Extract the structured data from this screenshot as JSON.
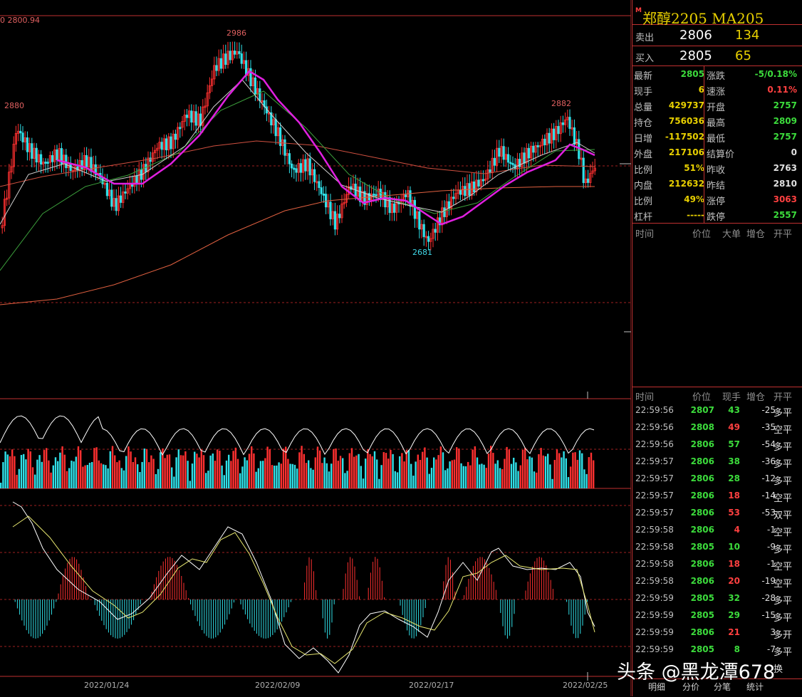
{
  "chart_header": {
    "ma_prefix": "0",
    "ma_value": "2800.94"
  },
  "peak_labels": {
    "left": "2880",
    "top": "2986",
    "bottom": "2681",
    "right": "2882"
  },
  "x_axis": [
    "2022/01/24",
    "2022/02/09",
    "2022/02/17",
    "2022/02/25"
  ],
  "quote": {
    "marker": "M",
    "title": "郑醇2205  MA205",
    "sell": {
      "label": "卖出",
      "price": "2806",
      "volume": "134"
    },
    "buy": {
      "label": "买入",
      "price": "2805",
      "volume": "65"
    }
  },
  "stats": [
    {
      "l1": "最新",
      "v1": "2805",
      "c1": "#3cdc3c",
      "l2": "涨跌",
      "v2": "-5/0.18%",
      "c2": "#3cdc3c"
    },
    {
      "l1": "现手",
      "v1": "6",
      "c1": "#e8d000",
      "l2": "速涨",
      "v2": "0.11%",
      "c2": "#ff4040"
    },
    {
      "l1": "总量",
      "v1": "429737",
      "c1": "#e8d000",
      "l2": "开盘",
      "v2": "2757",
      "c2": "#3cdc3c"
    },
    {
      "l1": "持仓",
      "v1": "756036",
      "c1": "#e8d000",
      "l2": "最高",
      "v2": "2809",
      "c2": "#3cdc3c"
    },
    {
      "l1": "日增",
      "v1": "-117502",
      "c1": "#e8d000",
      "l2": "最低",
      "v2": "2757",
      "c2": "#3cdc3c"
    },
    {
      "l1": "外盘",
      "v1": "217106",
      "c1": "#e8d000",
      "l2": "结算价",
      "v2": "0",
      "c2": "#e0e0e0"
    },
    {
      "l1": "比例",
      "v1": "51%",
      "c1": "#e8d000",
      "l2": "昨收",
      "v2": "2763",
      "c2": "#e0e0e0"
    },
    {
      "l1": "内盘",
      "v1": "212632",
      "c1": "#e8d000",
      "l2": "昨结",
      "v2": "2810",
      "c2": "#e0e0e0"
    },
    {
      "l1": "比例",
      "v1": "49%",
      "c1": "#e8d000",
      "l2": "涨停",
      "v2": "3063",
      "c2": "#ff4040"
    },
    {
      "l1": "杠杆",
      "v1": "-----",
      "c1": "#e8d000",
      "l2": "跌停",
      "v2": "2557",
      "c2": "#3cdc3c"
    }
  ],
  "big_order_header": [
    "时间",
    "价位",
    "大单",
    "增仓",
    "开平"
  ],
  "tick_header": [
    "时间",
    "价位",
    "现手",
    "增仓",
    "开平"
  ],
  "ticks": [
    {
      "time": "22:59:56",
      "price": "2807",
      "vol": "43",
      "vc": "#3cdc3c",
      "chg": "-25",
      "kind": "多平"
    },
    {
      "time": "22:59:56",
      "price": "2808",
      "vol": "49",
      "vc": "#ff4040",
      "chg": "-35",
      "kind": "空平"
    },
    {
      "time": "22:59:56",
      "price": "2806",
      "vol": "57",
      "vc": "#3cdc3c",
      "chg": "-54",
      "kind": "多平"
    },
    {
      "time": "22:59:57",
      "price": "2806",
      "vol": "38",
      "vc": "#3cdc3c",
      "chg": "-36",
      "kind": "多平"
    },
    {
      "time": "22:59:57",
      "price": "2806",
      "vol": "28",
      "vc": "#3cdc3c",
      "chg": "-12",
      "kind": "多平"
    },
    {
      "time": "22:59:57",
      "price": "2806",
      "vol": "18",
      "vc": "#ff4040",
      "chg": "-14",
      "kind": "空平"
    },
    {
      "time": "22:59:57",
      "price": "2806",
      "vol": "53",
      "vc": "#ff4040",
      "chg": "-53",
      "kind": "双平"
    },
    {
      "time": "22:59:58",
      "price": "2806",
      "vol": "4",
      "vc": "#ff4040",
      "chg": "-1",
      "kind": "空平"
    },
    {
      "time": "22:59:58",
      "price": "2805",
      "vol": "10",
      "vc": "#3cdc3c",
      "chg": "-9",
      "kind": "多平"
    },
    {
      "time": "22:59:58",
      "price": "2806",
      "vol": "18",
      "vc": "#ff4040",
      "chg": "-1",
      "kind": "空平"
    },
    {
      "time": "22:59:58",
      "price": "2806",
      "vol": "20",
      "vc": "#ff4040",
      "chg": "-19",
      "kind": "空平"
    },
    {
      "time": "22:59:59",
      "price": "2805",
      "vol": "32",
      "vc": "#3cdc3c",
      "chg": "-28",
      "kind": "多平"
    },
    {
      "time": "22:59:59",
      "price": "2805",
      "vol": "29",
      "vc": "#3cdc3c",
      "chg": "-15",
      "kind": "多平"
    },
    {
      "time": "22:59:59",
      "price": "2806",
      "vol": "21",
      "vc": "#ff4040",
      "chg": "3",
      "kind": "多开"
    },
    {
      "time": "22:59:59",
      "price": "2805",
      "vol": "8",
      "vc": "#3cdc3c",
      "chg": "-7",
      "kind": "多平"
    },
    {
      "time": "",
      "price": "",
      "vol": "",
      "vc": "#3cdc3c",
      "chg": "",
      "kind": "换"
    }
  ],
  "tabs": [
    "明细",
    "分价",
    "分笔",
    "统计"
  ],
  "watermark": "头条 @黑龙潭678",
  "colors": {
    "up": "#ff4040",
    "down": "#3cdc3c",
    "accent": "#e8d000",
    "grid": "#c03030"
  }
}
